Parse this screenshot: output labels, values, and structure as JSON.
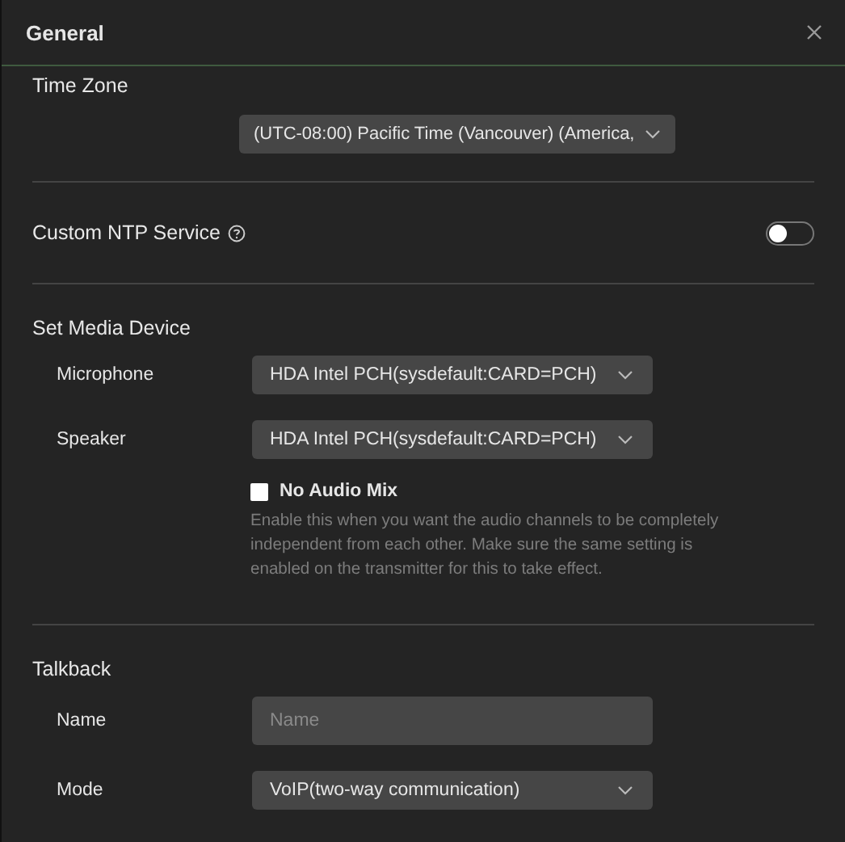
{
  "window": {
    "title": "General"
  },
  "time_zone": {
    "label": "Time Zone",
    "value": "(UTC-08:00) Pacific Time (Vancouver) (America,"
  },
  "ntp": {
    "label": "Custom NTP Service",
    "on": false
  },
  "media": {
    "title": "Set Media Device",
    "fields": [
      {
        "label": "Microphone",
        "value": "HDA Intel PCH(sysdefault:CARD=PCH)"
      },
      {
        "label": "Speaker",
        "value": "HDA Intel PCH(sysdefault:CARD=PCH)"
      }
    ],
    "no_audio_mix": {
      "label": "No Audio Mix",
      "checked": false,
      "description": "Enable this when you want the audio channels to be completely independent from each other. Make sure the same setting is enabled on the transmitter for this to take effect."
    }
  },
  "talkback": {
    "title": "Talkback",
    "fields": [
      {
        "kind": "input",
        "label": "Name",
        "placeholder": "Name"
      },
      {
        "kind": "select",
        "label": "Mode",
        "value": "VoIP(two-way communication)"
      }
    ]
  }
}
